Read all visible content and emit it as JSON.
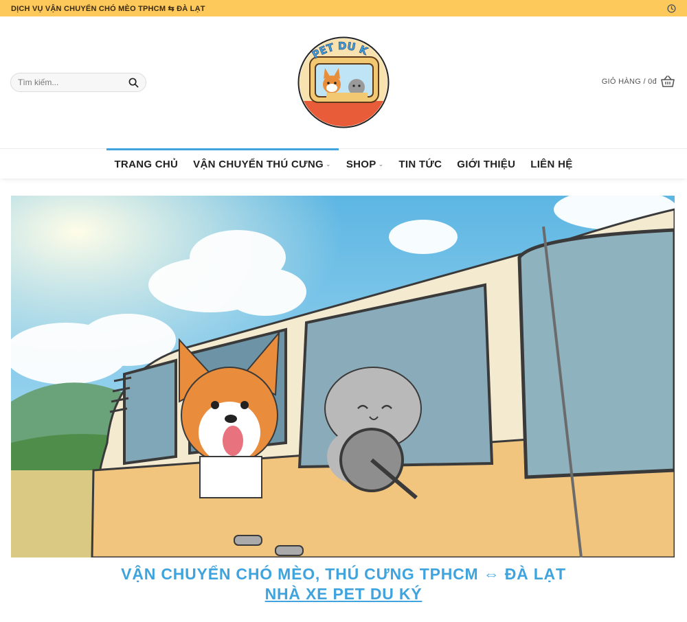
{
  "topbar": {
    "announcement": "DỊCH VỤ VẬN CHUYỂN CHÓ MÈO TPHCM ⇆ ĐÀ LẠT",
    "clock_icon": "clock-icon"
  },
  "header": {
    "search_placeholder": "Tìm kiếm...",
    "logo_text": "PET DU KÝ",
    "cart_label": "GIỎ HÀNG / 0đ"
  },
  "nav": {
    "items": [
      {
        "label": "TRANG CHỦ",
        "active": true,
        "dropdown": false
      },
      {
        "label": "VẬN CHUYỂN THÚ CƯNG",
        "active": true,
        "dropdown": true
      },
      {
        "label": "SHOP",
        "active": false,
        "dropdown": true
      },
      {
        "label": "TIN TỨC",
        "active": false,
        "dropdown": false
      },
      {
        "label": "GIỚI THIỆU",
        "active": false,
        "dropdown": false
      },
      {
        "label": "LIÊN HỆ",
        "active": false,
        "dropdown": false
      }
    ]
  },
  "headline": {
    "line1": "VẬN CHUYỂN CHÓ MÈO, THÚ CƯNG TPHCM ⇔ ĐÀ LẠT",
    "line2": "NHÀ XE PET DU KÝ"
  },
  "colors": {
    "topbar_bg": "#fdc95b",
    "accent": "#3fa4dd"
  }
}
